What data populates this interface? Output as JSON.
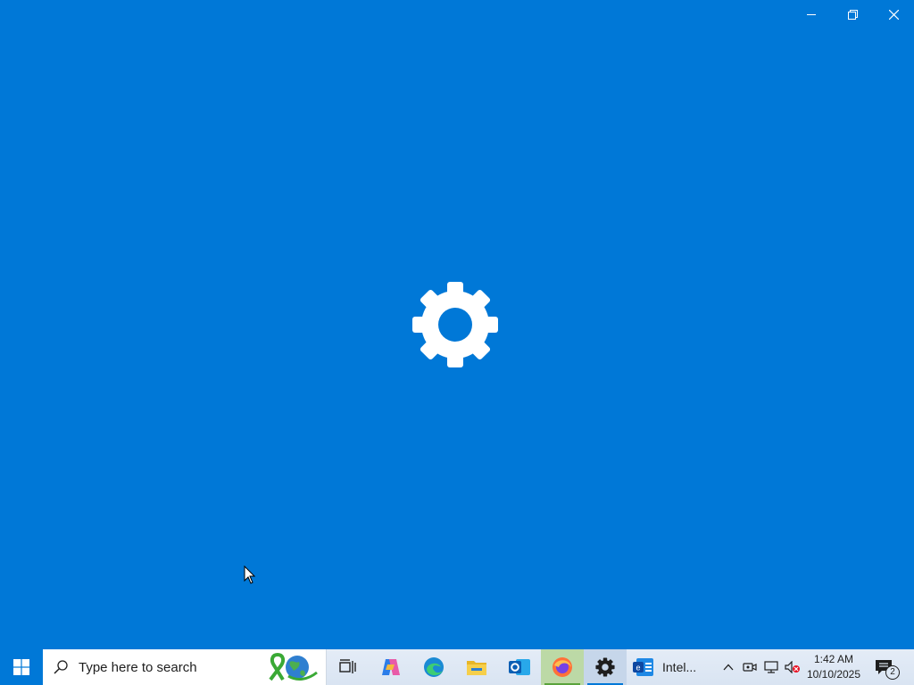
{
  "window": {
    "background": "#0078d7",
    "splash_icon": "gear-icon",
    "controls": [
      "minimize-icon",
      "restore-icon",
      "close-icon"
    ]
  },
  "taskbar": {
    "start_icon": "windows-logo-icon",
    "search": {
      "placeholder": "Type here to search",
      "icon": "search-icon",
      "art": "awareness-ribbon-globe-icon"
    },
    "apps": [
      {
        "name": "task-view",
        "icon": "task-view-icon"
      },
      {
        "name": "copilot",
        "icon": "copilot-icon"
      },
      {
        "name": "edge",
        "icon": "edge-icon"
      },
      {
        "name": "file-explorer",
        "icon": "folder-icon"
      },
      {
        "name": "outlook",
        "icon": "outlook-icon"
      },
      {
        "name": "firefox",
        "icon": "firefox-icon"
      },
      {
        "name": "settings",
        "icon": "gear-icon"
      }
    ],
    "intel_label": "Intel...",
    "tray": [
      "chevron-up-icon",
      "meet-now-icon",
      "network-icon",
      "volume-muted-icon"
    ],
    "clock": {
      "time": "1:42 AM",
      "date": "10/10/2025"
    },
    "notifications": {
      "count": "2"
    }
  }
}
